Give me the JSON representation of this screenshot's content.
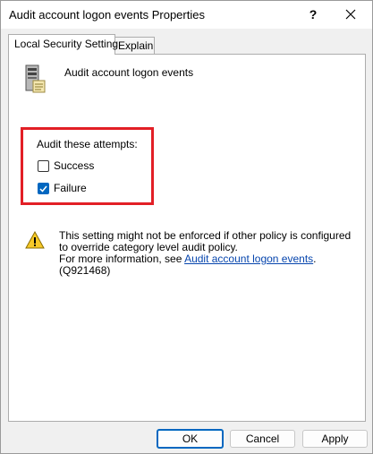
{
  "window": {
    "title": "Audit account logon events Properties",
    "help_glyph": "?",
    "close_icon": "close-icon"
  },
  "tabs": [
    {
      "label": "Local Security Setting",
      "selected": true
    },
    {
      "label": "Explain",
      "selected": false
    }
  ],
  "policy": {
    "name": "Audit account logon events",
    "icon": "server-policy-icon"
  },
  "audit": {
    "label": "Audit these attempts:",
    "highlight_color": "#e21f26",
    "options": [
      {
        "label": "Success",
        "checked": false
      },
      {
        "label": "Failure",
        "checked": true
      }
    ]
  },
  "warning": {
    "icon": "warning-icon",
    "line1": "This setting might not be enforced if other policy is configured to override category level audit policy.",
    "more_prefix": "For more information, see ",
    "link_text": "Audit account logon events",
    "more_suffix": ". (Q921468)"
  },
  "buttons": {
    "ok": "OK",
    "cancel": "Cancel",
    "apply": "Apply"
  },
  "colors": {
    "accent": "#0067c0",
    "link": "#0645ad"
  }
}
